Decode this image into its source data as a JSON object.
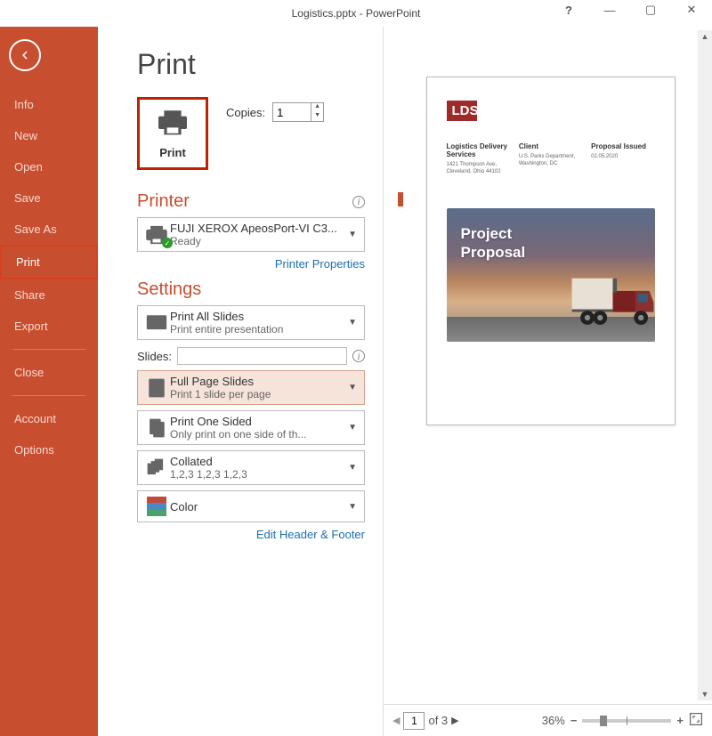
{
  "title": "Logistics.pptx - PowerPoint",
  "sidebar": {
    "items": [
      {
        "label": "Info"
      },
      {
        "label": "New"
      },
      {
        "label": "Open"
      },
      {
        "label": "Save"
      },
      {
        "label": "Save As"
      },
      {
        "label": "Print"
      },
      {
        "label": "Share"
      },
      {
        "label": "Export"
      },
      {
        "label": "Close"
      }
    ],
    "items2": [
      {
        "label": "Account"
      },
      {
        "label": "Options"
      }
    ]
  },
  "page": {
    "title": "Print",
    "print_button_label": "Print",
    "copies_label": "Copies:",
    "copies_value": "1",
    "printer_header": "Printer",
    "printer_name": "FUJI XEROX ApeosPort-VI C3...",
    "printer_status": "Ready",
    "printer_props_link": "Printer Properties",
    "settings_header": "Settings",
    "setting_all_slides": "Print All Slides",
    "setting_all_slides_sub": "Print entire presentation",
    "slides_label": "Slides:",
    "setting_fullpage": "Full Page Slides",
    "setting_fullpage_sub": "Print 1 slide per page",
    "setting_onesided": "Print One Sided",
    "setting_onesided_sub": "Only print on one side of th...",
    "setting_collated": "Collated",
    "setting_collated_sub": "1,2,3    1,2,3    1,2,3",
    "setting_color": "Color",
    "edit_hf_link": "Edit Header & Footer"
  },
  "preview": {
    "brand": "LDS",
    "col1_h": "Logistics Delivery Services",
    "col1_l": "1421 Thompson Ave, Cleveland, Ohio 44102",
    "col2_h": "Client",
    "col2_l": "U.S. Parks Department, Washington, DC",
    "col3_h": "Proposal Issued",
    "col3_l": "02.05.2020",
    "photo_title_l1": "Project",
    "photo_title_l2": "Proposal"
  },
  "footer": {
    "page_value": "1",
    "page_total": "of 3",
    "zoom_percent": "36%"
  }
}
